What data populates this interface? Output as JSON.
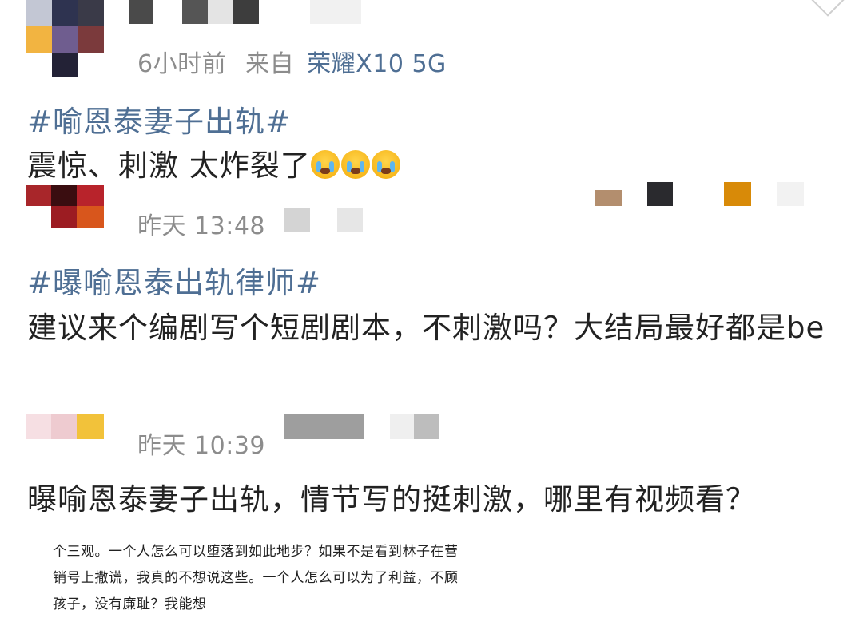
{
  "comments": [
    {
      "time": "6小时前",
      "source_prefix": "来自",
      "device": "荣耀X10 5G",
      "hashtag": "#喻恩泰妻子出轨#",
      "text": "震惊、刺激 太炸裂了",
      "emoji": [
        "crying-face-icon",
        "crying-face-icon",
        "crying-face-icon"
      ]
    },
    {
      "time": "昨天 13:48",
      "hashtag": "#曝喻恩泰出轨律师#",
      "text": "建议来个编剧写个短剧剧本，不刺激吗？大结局最好都是be"
    },
    {
      "time": "昨天 10:39",
      "text": "曝喻恩泰妻子出轨，情节写的挺刺激，哪里有视频看？"
    }
  ],
  "excerpt": {
    "text": "个三观。一个人怎么可以堕落到如此地步？如果不是看到林子在营销号上撒谎，我真的不想说这些。一个人怎么可以为了利益，不顾孩子，没有廉耻？我能想"
  },
  "colors": {
    "link": "#4f6f94",
    "meta": "#8c8c8c",
    "text": "#222222"
  }
}
